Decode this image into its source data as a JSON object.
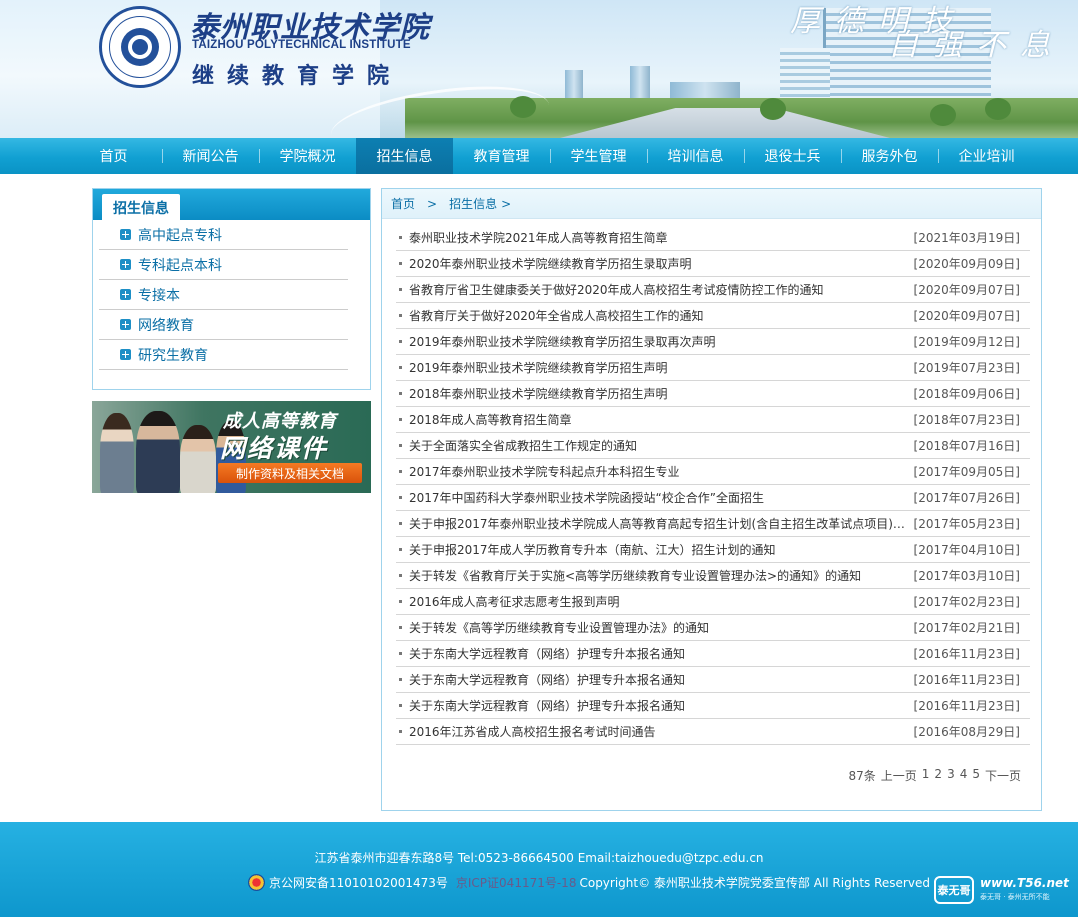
{
  "header": {
    "school_cn": "泰州职业技术学院",
    "school_en": "TAIZHOU POLYTECHNICAL INSTITUTE",
    "school_sub": "继续教育学院",
    "motto_a": "厚德明技",
    "motto_b": "自强不息"
  },
  "nav": {
    "items": [
      "首页",
      "新闻公告",
      "学院概况",
      "招生信息",
      "教育管理",
      "学生管理",
      "培训信息",
      "退役士兵",
      "服务外包",
      "企业培训"
    ],
    "active_index": 3
  },
  "sidebar": {
    "title": "招生信息",
    "items": [
      "高中起点专科",
      "专科起点本科",
      "专接本",
      "网络教育",
      "研究生教育"
    ]
  },
  "banner": {
    "line1": "成人高等教育",
    "line2": "网络课件",
    "line3": "制作资料及相关文档"
  },
  "breadcrumb": {
    "home": "首页",
    "current": "招生信息",
    "sep": ">"
  },
  "news": [
    {
      "title": "泰州职业技术学院2021年成人高等教育招生简章",
      "date": "[2021年03月19日]"
    },
    {
      "title": "2020年泰州职业技术学院继续教育学历招生录取声明",
      "date": "[2020年09月09日]"
    },
    {
      "title": "省教育厅省卫生健康委关于做好2020年成人高校招生考试疫情防控工作的通知",
      "date": "[2020年09月07日]"
    },
    {
      "title": "省教育厅关于做好2020年全省成人高校招生工作的通知",
      "date": "[2020年09月07日]"
    },
    {
      "title": "2019年泰州职业技术学院继续教育学历招生录取再次声明",
      "date": "[2019年09月12日]"
    },
    {
      "title": "2019年泰州职业技术学院继续教育学历招生声明",
      "date": "[2019年07月23日]"
    },
    {
      "title": "2018年泰州职业技术学院继续教育学历招生声明",
      "date": "[2018年09月06日]"
    },
    {
      "title": "2018年成人高等教育招生简章",
      "date": "[2018年07月23日]"
    },
    {
      "title": "关于全面落实全省成教招生工作规定的通知",
      "date": "[2018年07月16日]"
    },
    {
      "title": "2017年泰州职业技术学院专科起点升本科招生专业",
      "date": "[2017年09月05日]"
    },
    {
      "title": "2017年中国药科大学泰州职业技术学院函授站“校企合作”全面招生",
      "date": "[2017年07月26日]"
    },
    {
      "title": "关于申报2017年泰州职业技术学院成人高等教育高起专招生计划(含自主招生改革试点项目)…",
      "date": "[2017年05月23日]"
    },
    {
      "title": "关于申报2017年成人学历教育专升本（南航、江大）招生计划的通知",
      "date": "[2017年04月10日]"
    },
    {
      "title": "关于转发《省教育厅关于实施<高等学历继续教育专业设置管理办法>的通知》的通知",
      "date": "[2017年03月10日]"
    },
    {
      "title": "2016年成人高考征求志愿考生报到声明",
      "date": "[2017年02月23日]"
    },
    {
      "title": "关于转发《高等学历继续教育专业设置管理办法》的通知",
      "date": "[2017年02月21日]"
    },
    {
      "title": "关于东南大学远程教育（网络）护理专升本报名通知",
      "date": "[2016年11月23日]"
    },
    {
      "title": "关于东南大学远程教育（网络）护理专升本报名通知",
      "date": "[2016年11月23日]"
    },
    {
      "title": "关于东南大学远程教育（网络）护理专升本报名通知",
      "date": "[2016年11月23日]"
    },
    {
      "title": "2016年江苏省成人高校招生报名考试时间通告",
      "date": "[2016年08月29日]"
    }
  ],
  "pager": {
    "total": "87条",
    "prev": "上一页",
    "pages": [
      "1",
      "2",
      "3",
      "4",
      "5"
    ],
    "next": "下一页"
  },
  "footer": {
    "address": "江苏省泰州市迎春东路8号 Tel:0523-86664500 Email:taizhouedu@tzpc.edu.cn",
    "police": "京公网安备11010102001473号",
    "icp": "京ICP证041171号-18",
    "copyright": "Copyright© 泰州职业技术学院党委宣传部 All Rights Reserved"
  },
  "watermark": {
    "badge": "泰无哥",
    "url": "www.T56.net",
    "tag": "泰无哥 · 泰州无所不能"
  }
}
